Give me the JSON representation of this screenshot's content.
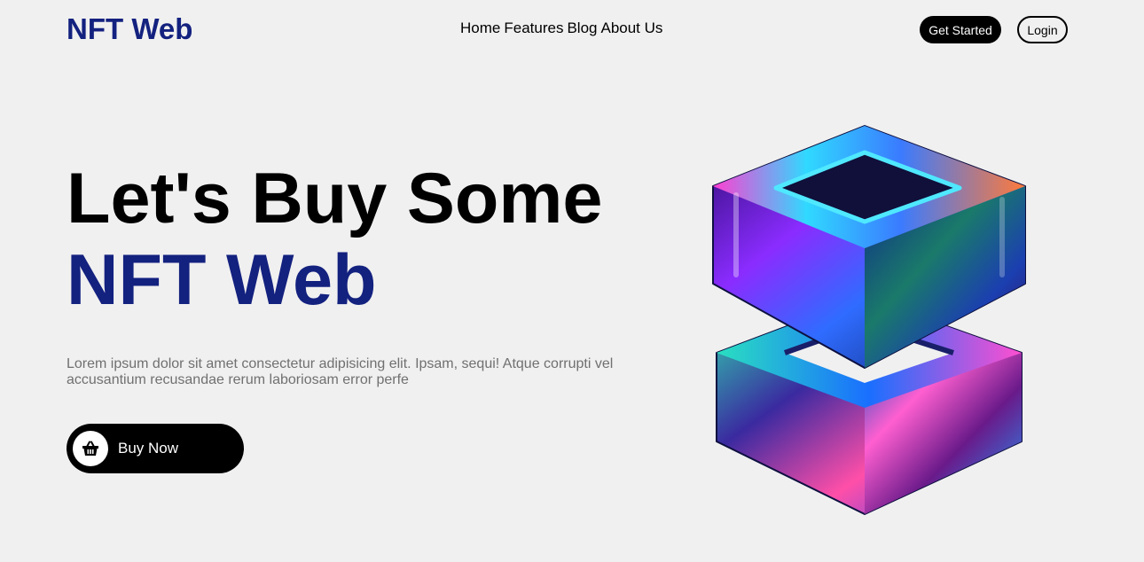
{
  "header": {
    "logo": "NFT Web",
    "nav": [
      "Home",
      "Features",
      "Blog",
      "About Us"
    ],
    "get_started_label": "Get Started",
    "login_label": "Login"
  },
  "hero": {
    "title_line1": "Let's Buy Some",
    "title_line2": "NFT Web",
    "description": "Lorem ipsum dolor sit amet consectetur adipisicing elit. Ipsam, sequi! Atque corrupti vel accusantium recusandae rerum laboriosam error perfe",
    "cta_label": "Buy Now",
    "cta_icon": "basket-icon",
    "art_icon": "iridescent-cube-illustration"
  },
  "colors": {
    "background": "#f0f0f0",
    "brand": "#13217f",
    "button": "#000000",
    "muted_text": "#707070"
  }
}
